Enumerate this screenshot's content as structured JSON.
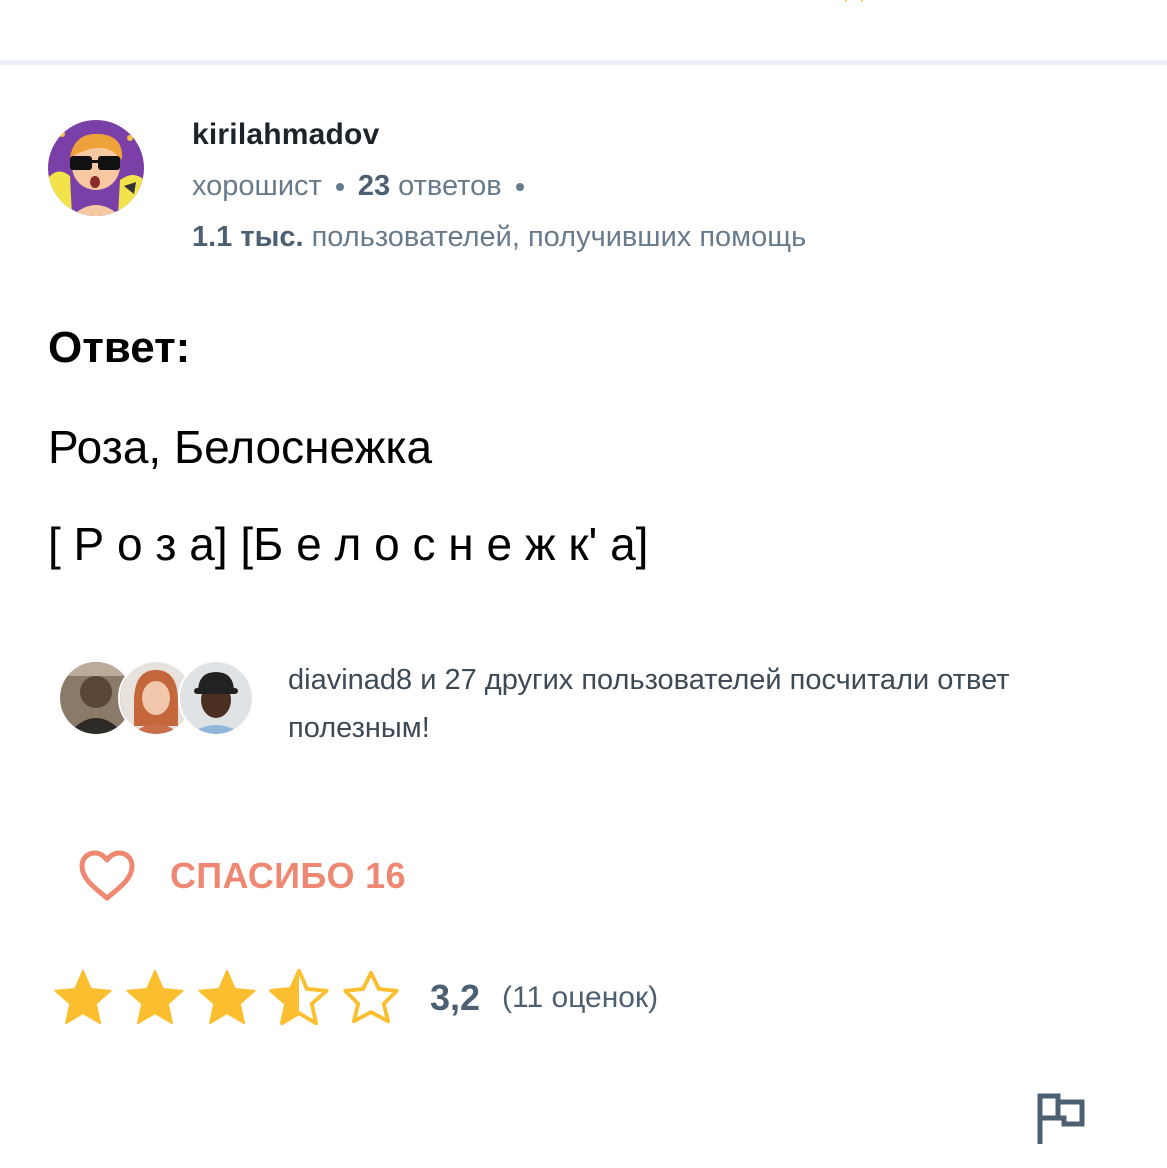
{
  "author": {
    "username": "kirilahmadov",
    "rank": "хорошист",
    "answers_count": "23",
    "answers_label": "ответов",
    "helped_count": "1.1 тыс.",
    "helped_label": "пользователей, получивших помощь"
  },
  "answer": {
    "heading": "Ответ:",
    "line1": "Роза, Белоснежка",
    "line2": "[ Р о з а] [Б е л о с н е ж к' а]"
  },
  "helpers": {
    "text": "diavinad8 и 27 других пользователей посчитали ответ полезным!"
  },
  "thanks": {
    "label": "СПАСИБО 16"
  },
  "rating": {
    "value": "3,2",
    "count_label": "(11 оценок)",
    "stars_filled": 3.5,
    "stars_total": 5
  },
  "icons": {
    "heart": "heart-icon",
    "star": "star-icon",
    "report": "flag-icon"
  },
  "colors": {
    "accent_thanks": "#ee8873",
    "star_gold": "#fbbe2e",
    "meta_gray": "#687b8c"
  }
}
